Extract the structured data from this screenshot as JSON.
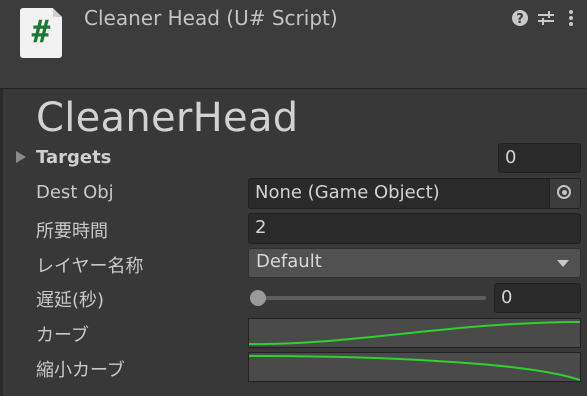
{
  "header": {
    "title": "Cleaner Head (U# Script)",
    "script_icon_glyph": "#",
    "icons": [
      "help-icon",
      "settings-icon",
      "menu-icon"
    ]
  },
  "component": {
    "title": "CleanerHead"
  },
  "fields": {
    "targets": {
      "label": "Targets",
      "value": "0"
    },
    "dest_obj": {
      "label": "Dest Obj",
      "value": "None (Game Object)",
      "icon": "object-picker-icon"
    },
    "duration": {
      "label": "所要時間",
      "value": "2"
    },
    "layer_name": {
      "label": "レイヤー名称",
      "value": "Default"
    },
    "delay": {
      "label": "遅延(秒)",
      "value": "0",
      "slider_fraction": 0.0
    },
    "curve": {
      "label": "カーブ"
    },
    "shrink_curve": {
      "label": "縮小カーブ"
    }
  },
  "colors": {
    "curve_green": "#2fd12f",
    "script_icon_green": "#1b7a32"
  }
}
